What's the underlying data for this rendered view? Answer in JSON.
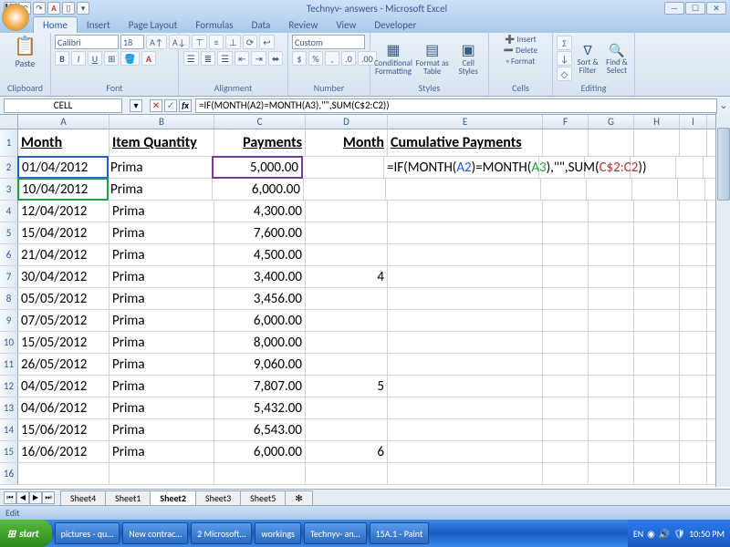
{
  "title": "Technyv- answers - Microsoft Excel",
  "tabs": [
    "Home",
    "Insert",
    "Page Layout",
    "Formulas",
    "Data",
    "Review",
    "View",
    "Developer"
  ],
  "active_tab": "Home",
  "ribbon": {
    "clipboard": "Clipboard",
    "paste": "Paste",
    "font": "Font",
    "font_name": "Calibri",
    "font_size": "18",
    "alignment": "Alignment",
    "number": "Number",
    "number_format": "Custom",
    "styles": "Styles",
    "cond_fmt": "Conditional Formatting",
    "fmt_table": "Format as Table",
    "cell_styles": "Cell Styles",
    "cells": "Cells",
    "insert": "Insert",
    "delete": "Delete",
    "format": "Format",
    "editing": "Editing",
    "sort": "Sort & Filter",
    "find": "Find & Select"
  },
  "namebox": "CELL",
  "formula": "=IF(MONTH(A2)=MONTH(A3),\"\",SUM(C$2:C2))",
  "columns": [
    "A",
    "B",
    "C",
    "D",
    "E",
    "F",
    "G",
    "H",
    "I"
  ],
  "headers": {
    "A": "Month",
    "B": "Item Quantity",
    "C": "Payments",
    "D": "Month",
    "E": "Cumulative Payments"
  },
  "rows": [
    {
      "n": 2,
      "A": "01/04/2012",
      "B": "Prima",
      "C": "5,000.00",
      "D": "",
      "E_formula": "=IF(MONTH(A2)=MONTH(A3),\"\",SUM(C$2:C2))"
    },
    {
      "n": 3,
      "A": "10/04/2012",
      "B": "Prima",
      "C": "6,000.00",
      "D": ""
    },
    {
      "n": 4,
      "A": "12/04/2012",
      "B": "Prima",
      "C": "4,300.00",
      "D": ""
    },
    {
      "n": 5,
      "A": "15/04/2012",
      "B": "Prima",
      "C": "7,600.00",
      "D": ""
    },
    {
      "n": 6,
      "A": "21/04/2012",
      "B": "Prima",
      "C": "4,500.00",
      "D": ""
    },
    {
      "n": 7,
      "A": "30/04/2012",
      "B": "Prima",
      "C": "3,400.00",
      "D": "4"
    },
    {
      "n": 8,
      "A": "05/05/2012",
      "B": "Prima",
      "C": "3,456.00",
      "D": ""
    },
    {
      "n": 9,
      "A": "07/05/2012",
      "B": "Prima",
      "C": "6,000.00",
      "D": ""
    },
    {
      "n": 10,
      "A": "15/05/2012",
      "B": "Prima",
      "C": "8,000.00",
      "D": ""
    },
    {
      "n": 11,
      "A": "26/05/2012",
      "B": "Prima",
      "C": "9,060.00",
      "D": ""
    },
    {
      "n": 12,
      "A": "04/05/2012",
      "B": "Prima",
      "C": "7,807.00",
      "D": "5"
    },
    {
      "n": 13,
      "A": "04/06/2012",
      "B": "Prima",
      "C": "5,432.00",
      "D": ""
    },
    {
      "n": 14,
      "A": "15/06/2012",
      "B": "Prima",
      "C": "6,543.00",
      "D": ""
    },
    {
      "n": 15,
      "A": "16/06/2012",
      "B": "Prima",
      "C": "6,000.00",
      "D": "6"
    }
  ],
  "visible_rows_after": [
    16
  ],
  "sheet_tabs": [
    "Sheet4",
    "Sheet1",
    "Sheet2",
    "Sheet3",
    "Sheet5"
  ],
  "active_sheet": "Sheet2",
  "status": "Edit",
  "taskbar": {
    "start": "start",
    "items": [
      "pictures - qu…",
      "New contrac…",
      "2 Microsoft…",
      "workings",
      "Technyv- an…",
      "15A.1 - Paint"
    ],
    "lang": "EN",
    "time": "10:50 PM"
  }
}
